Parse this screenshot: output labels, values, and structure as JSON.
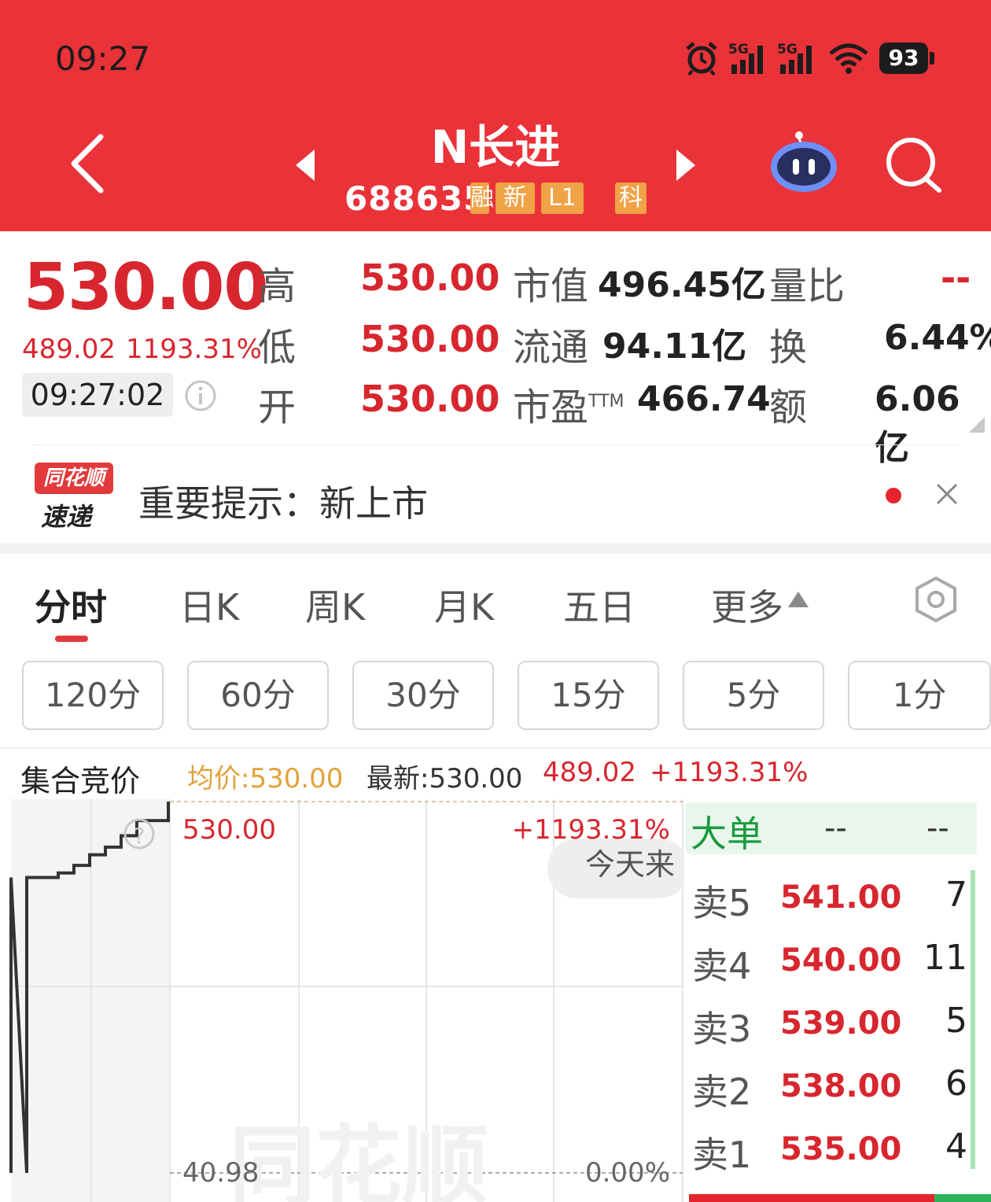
{
  "status_bar": {
    "time": "09:27",
    "battery": "93",
    "net1": "5G",
    "net2": "5G",
    "icons": [
      "alarm-icon",
      "signal-5g-icon",
      "signal-5g-icon",
      "wifi-icon",
      "battery-icon"
    ]
  },
  "header": {
    "name": "N长进",
    "code": "688635",
    "tags": [
      "融",
      "新",
      "L1",
      "科"
    ],
    "colors": {
      "brand": "#ea3239",
      "tag": "#f0a246"
    }
  },
  "quote": {
    "price": "530.00",
    "change": "489.02",
    "change_pct": "1193.31%",
    "time": "09:27:02",
    "high_label": "高",
    "high": "530.00",
    "low_label": "低",
    "low": "530.00",
    "open_label": "开",
    "open": "530.00",
    "mcap_label": "市值",
    "mcap": "496.45亿",
    "float_label": "流通",
    "float": "94.11亿",
    "pe_label": "市盈",
    "pe_sup": "TTM",
    "pe": "466.74",
    "vr_label": "量比",
    "vr": "--",
    "turnover_label": "换",
    "turnover": "6.44%",
    "amount_label": "额",
    "amount": "6.06亿"
  },
  "tip": {
    "logo_top": "同花顺",
    "logo_bottom": "速递",
    "text": "重要提示：新上市"
  },
  "tabs": [
    "分时",
    "日K",
    "周K",
    "月K",
    "五日",
    "更多"
  ],
  "intervals": [
    "120分",
    "60分",
    "30分",
    "15分",
    "5分",
    "1分"
  ],
  "chart_header": {
    "title": "集合竞价",
    "avg": "均价:530.00",
    "latest": "最新:530.00",
    "change": "489.02",
    "pct": "+1193.31%"
  },
  "chart": {
    "top_price": "530.00",
    "top_pct": "+1193.31%",
    "bottom_price": "40.98",
    "bottom_pct": "0.00%",
    "overlay_text": "今天来",
    "watermark": "同花顺"
  },
  "orderbook": {
    "big_order_label": "大单",
    "big_order_v1": "--",
    "big_order_v2": "--",
    "rows": [
      {
        "side": "卖5",
        "price": "541.00",
        "vol": "7"
      },
      {
        "side": "卖4",
        "price": "540.00",
        "vol": "11"
      },
      {
        "side": "卖3",
        "price": "539.00",
        "vol": "5"
      },
      {
        "side": "卖2",
        "price": "538.00",
        "vol": "6"
      },
      {
        "side": "卖1",
        "price": "535.00",
        "vol": "4"
      }
    ]
  },
  "chart_data": {
    "type": "line",
    "note_series": "auction price path",
    "y_range": [
      40.98,
      530.0
    ],
    "x": [
      0,
      1,
      2,
      3,
      4,
      5,
      6,
      7,
      8,
      9,
      10
    ],
    "values": [
      40.98,
      430,
      430,
      436,
      446,
      460,
      470,
      485,
      505,
      505,
      530
    ]
  }
}
